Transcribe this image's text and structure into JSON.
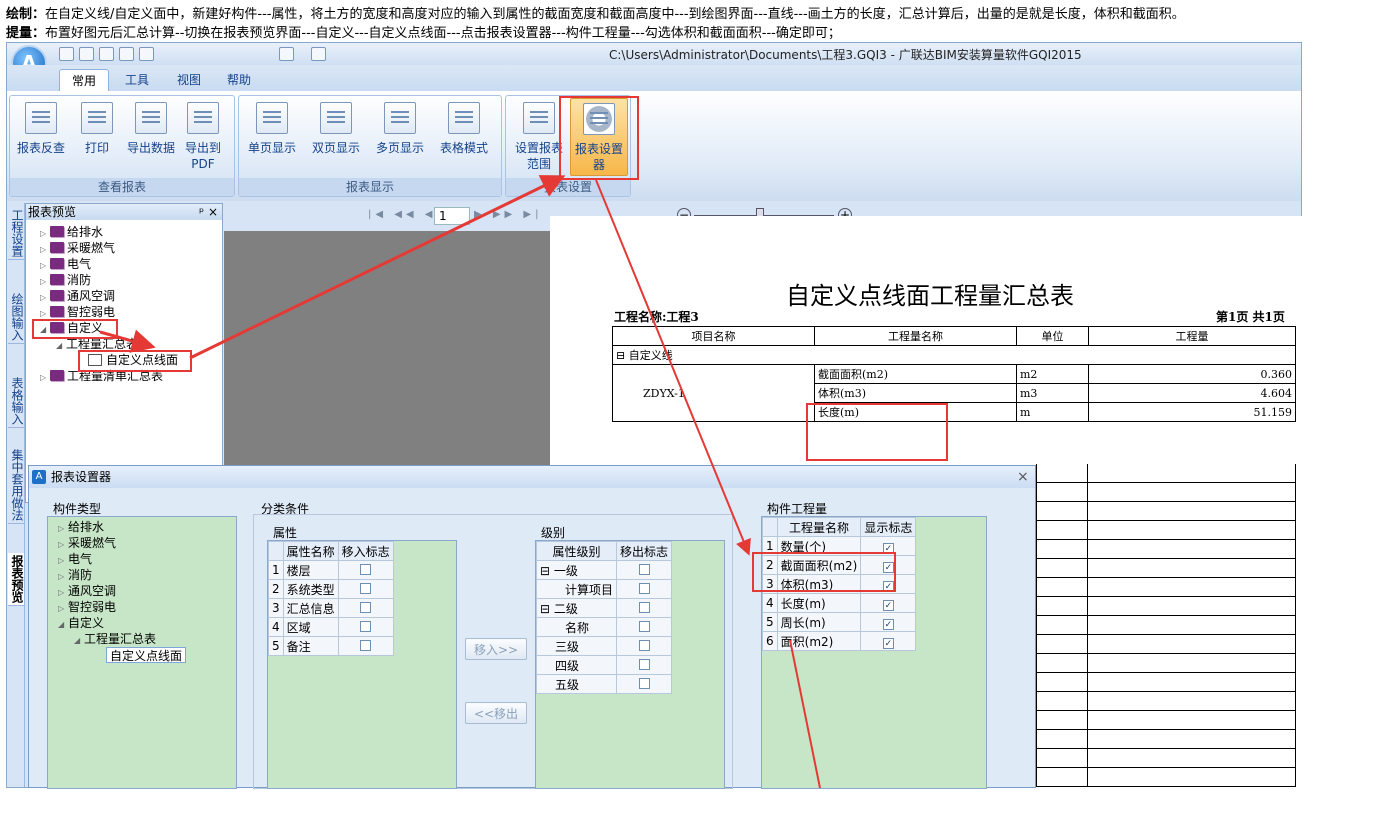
{
  "instructions": {
    "draw_label": "绘制：",
    "draw_text": "在自定义线/自定义面中，新建好构件---属性，将土方的宽度和高度对应的输入到属性的截面宽度和截面高度中---到绘图界面---直线---画土方的长度，汇总计算后，出量的是就是长度，体积和截面积。",
    "extract_label": "提量：",
    "extract_text": "布置好图元后汇总计算--切换在报表预览界面---自定义---自定义点线面---点击报表设置器---构件工程量---勾选体积和截面面积---确定即可；"
  },
  "window": {
    "title": "C:\\Users\\Administrator\\Documents\\工程3.GQI3 - 广联达BIM安装算量软件GQI2015",
    "logo": "A"
  },
  "tabs": [
    "常用",
    "工具",
    "视图",
    "帮助"
  ],
  "ribbon": {
    "groups": [
      {
        "label": "查看报表",
        "buttons": [
          "报表反查",
          "打印",
          "导出数据",
          "导出到PDF"
        ]
      },
      {
        "label": "报表显示",
        "buttons": [
          "单页显示",
          "双页显示",
          "多页显示",
          "表格模式"
        ]
      },
      {
        "label": "报表设置",
        "buttons": [
          "设置报表范围",
          "报表设置器"
        ]
      }
    ]
  },
  "vtabs": [
    "工程设置",
    "绘图输入",
    "表格输入",
    "集中套用做法",
    "报表预览"
  ],
  "tree_panel": {
    "title": "报表预览",
    "items": [
      "给排水",
      "采暖燃气",
      "电气",
      "消防",
      "通风空调",
      "智控弱电",
      "自定义",
      "工程量汇总表",
      "自定义点线面",
      "工程量清单汇总表"
    ]
  },
  "nav": {
    "page": "1"
  },
  "report": {
    "title": "自定义点线面工程量汇总表",
    "project": "工程名称:工程3",
    "page_info": "第1页 共1页",
    "headers": [
      "项目名称",
      "工程量名称",
      "单位",
      "工程量"
    ],
    "group": "自定义线",
    "item": "ZDYX-1",
    "rows": [
      {
        "name": "截面面积(m2)",
        "unit": "m2",
        "value": "0.360"
      },
      {
        "name": "体积(m3)",
        "unit": "m3",
        "value": "4.604"
      },
      {
        "name": "长度(m)",
        "unit": "m",
        "value": "51.159"
      }
    ]
  },
  "dialog": {
    "title": "报表设置器",
    "close": "×",
    "types_label": "构件类型",
    "types": [
      "给排水",
      "采暖燃气",
      "电气",
      "消防",
      "通风空调",
      "智控弱电",
      "自定义",
      "工程量汇总表",
      "自定义点线面"
    ],
    "cond_label": "分类条件",
    "attr_label": "属性",
    "attr_headers": [
      "属性名称",
      "移入标志"
    ],
    "attrs": [
      "楼层",
      "系统类型",
      "汇总信息",
      "区域",
      "备注"
    ],
    "move_in": "移入>>",
    "move_out": "<<移出",
    "level_label": "级别",
    "level_headers": [
      "属性级别",
      "移出标志"
    ],
    "levels": [
      "一级",
      "计算项目",
      "二级",
      "名称",
      "三级",
      "四级",
      "五级"
    ],
    "qty_label": "构件工程量",
    "qty_headers": [
      "工程量名称",
      "显示标志"
    ],
    "qtys": [
      {
        "name": "数量(个)",
        "checked": true
      },
      {
        "name": "截面面积(m2)",
        "checked": true
      },
      {
        "name": "体积(m3)",
        "checked": true
      },
      {
        "name": "长度(m)",
        "checked": true
      },
      {
        "name": "周长(m)",
        "checked": true
      },
      {
        "name": "面积(m2)",
        "checked": true
      }
    ]
  },
  "colors": {
    "annotation": "#e53935",
    "tree_pane": "#c7e6c7",
    "ribbon_highlight": "#f7b749"
  }
}
